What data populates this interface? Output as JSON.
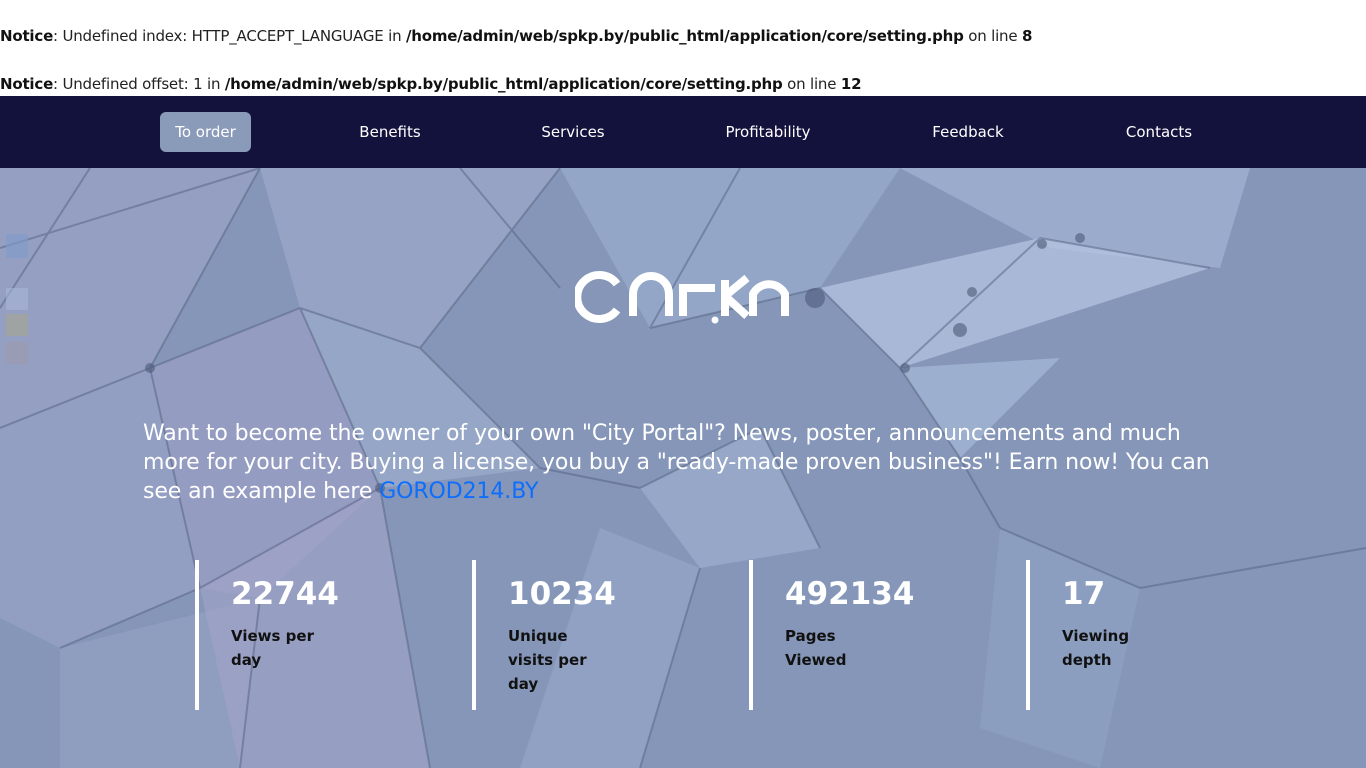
{
  "notices": [
    {
      "label": "Notice",
      "text": ": Undefined index: HTTP_ACCEPT_LANGUAGE in ",
      "path": "/home/admin/web/spkp.by/public_html/application/core/setting.php",
      "on_line": " on line ",
      "line": "8"
    },
    {
      "label": "Notice",
      "text": ": Undefined offset: 1 in ",
      "path": "/home/admin/web/spkp.by/public_html/application/core/setting.php",
      "on_line": " on line ",
      "line": "12"
    }
  ],
  "nav": {
    "items": [
      {
        "label": "To order",
        "active": true
      },
      {
        "label": "Benefits"
      },
      {
        "label": "Services"
      },
      {
        "label": "Profitability"
      },
      {
        "label": "Feedback"
      },
      {
        "label": "Contacts"
      }
    ]
  },
  "hero": {
    "logo_text": "onkn",
    "headline": "Want to become the owner of your own \"City Portal\"? News, poster, announcements and much more for your city. Buying a license, you buy a \"ready-made proven business\"! Earn now! You can see an example here ",
    "link_text": "GOROD214.BY",
    "link_color": "#0d6efd"
  },
  "stats": [
    {
      "value": "22744",
      "label": "Views per day"
    },
    {
      "value": "10234",
      "label": "Unique visits per day"
    },
    {
      "value": "492134",
      "label": "Pages Viewed"
    },
    {
      "value": "17",
      "label": "Viewing depth"
    }
  ],
  "colors": {
    "navbar": "#13123d",
    "active_nav": "#8a9ab9",
    "hero_bg": "#8596b8"
  }
}
